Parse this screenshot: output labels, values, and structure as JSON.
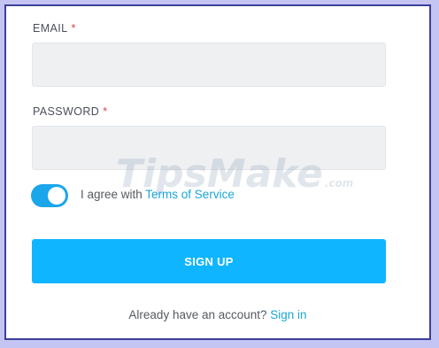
{
  "form": {
    "email": {
      "label": "EMAIL",
      "required_mark": "*",
      "value": ""
    },
    "password": {
      "label": "PASSWORD",
      "required_mark": "*",
      "value": ""
    },
    "terms": {
      "toggle_on": true,
      "text": "I agree with ",
      "link": "Terms of Service"
    },
    "signup_button": "SIGN UP",
    "signin": {
      "text": "Already have an account? ",
      "link": "Sign in"
    }
  },
  "watermark": {
    "text": "TipsMake",
    "suffix": ".com"
  },
  "colors": {
    "accent": "#0fb5ff",
    "toggle": "#1aa6ea",
    "link": "#1aa6d8",
    "required": "#e0424c",
    "field_bg": "#eef0f2",
    "page_bg": "#c4c5f3",
    "frame_border": "#3d3f99"
  }
}
